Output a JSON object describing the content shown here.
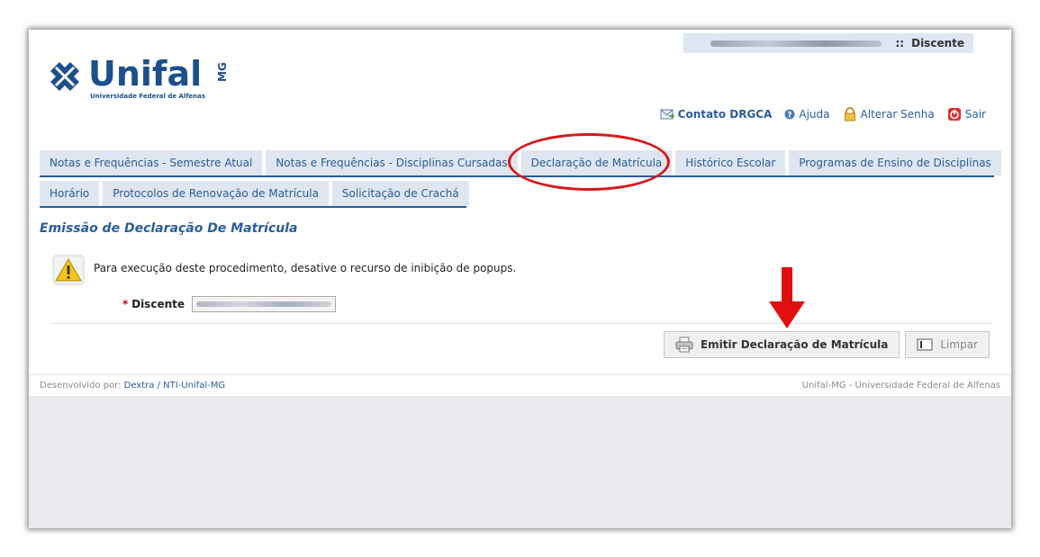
{
  "header": {
    "logo_brand": "Unifal",
    "logo_suffix": "MG",
    "logo_subtitle": "Universidade Federal de Alfenas",
    "user_separator": "::",
    "user_role": "Discente"
  },
  "toplinks": [
    {
      "label": "Contato DRGCA",
      "icon": "mail-icon"
    },
    {
      "label": "Ajuda",
      "icon": "help-icon"
    },
    {
      "label": "Alterar Senha",
      "icon": "lock-icon"
    },
    {
      "label": "Sair",
      "icon": "power-icon"
    }
  ],
  "tabs_row1": [
    "Notas e Frequências - Semestre Atual",
    "Notas e Frequências - Disciplinas Cursadas",
    "Declaração de Matrícula",
    "Histórico Escolar",
    "Programas de Ensino de Disciplinas"
  ],
  "tabs_row2": [
    "Horário",
    "Protocolos de Renovação de Matrícula",
    "Solicitação de Crachá"
  ],
  "main": {
    "title": "Emissão de Declaração De Matrícula",
    "warning": "Para execução deste procedimento, desative o recurso de inibição de popups.",
    "field_required_mark": "*",
    "field_label": "Discente",
    "emit_button": "Emitir Declaração de Matrícula",
    "clear_button": "Limpar"
  },
  "footer": {
    "dev_prefix": "Desenvolvido por:",
    "dev_link": "Dextra / NTI-Unifal-MG",
    "org": "Unifal-MG - Universidade Federal de Alfenas"
  },
  "colors": {
    "accent": "#2a5d98",
    "highlight": "#d61a1a",
    "tab_bg": "#dfe6ef"
  }
}
